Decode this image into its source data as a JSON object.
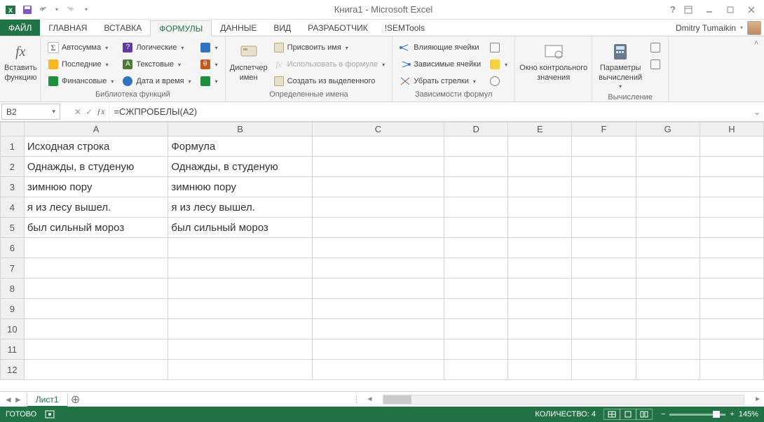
{
  "titlebar": {
    "title": "Книга1 - Microsoft Excel"
  },
  "tabs": {
    "file": "ФАЙЛ",
    "items": [
      "ГЛАВНАЯ",
      "ВСТАВКА",
      "ФОРМУЛЫ",
      "ДАННЫЕ",
      "ВИД",
      "РАЗРАБОТЧИК",
      "!SEMTools"
    ],
    "active": "ФОРМУЛЫ",
    "user": "Dmitry Tumaikin"
  },
  "ribbon": {
    "g0": {
      "label": "",
      "insert_fn_line1": "Вставить",
      "insert_fn_line2": "функцию"
    },
    "g1": {
      "label": "Библиотека функций",
      "autosum": "Автосумма",
      "recent": "Последние",
      "financial": "Финансовые",
      "logical": "Логические",
      "text": "Текстовые",
      "datetime": "Дата и время"
    },
    "g2": {
      "label": "Определенные имена",
      "name_mgr_line1": "Диспетчер",
      "name_mgr_line2": "имен",
      "define": "Присвоить имя",
      "use": "Использовать в формуле",
      "create": "Создать из выделенного"
    },
    "g3": {
      "label": "Зависимости формул",
      "precedents": "Влияющие ячейки",
      "dependents": "Зависимые ячейки",
      "remove": "Убрать стрелки"
    },
    "g4": {
      "label": "",
      "watch_line1": "Окно контрольного",
      "watch_line2": "значения"
    },
    "g5": {
      "label": "Вычисление",
      "calc_line1": "Параметры",
      "calc_line2": "вычислений"
    }
  },
  "fbar": {
    "cell": "B2",
    "formula": "=СЖПРОБЕЛЫ(A2)"
  },
  "grid": {
    "cols": [
      "A",
      "B",
      "C",
      "D",
      "E",
      "F",
      "G",
      "H"
    ],
    "rows": [
      1,
      2,
      3,
      4,
      5,
      6,
      7,
      8,
      9,
      10,
      11,
      12
    ],
    "data": {
      "A1": "Исходная строка",
      "B1": "Формула",
      "A2": "   Однажды, в студеную",
      "B2": "Однажды, в студеную",
      "A3": " зимнюю пору",
      "B3": "зимнюю пору",
      "A4": " я из лесу вышел.",
      "B4": "я из лесу вышел.",
      "A5": " был сильный мороз",
      "B5": "был сильный мороз"
    }
  },
  "sheets": {
    "active": "Лист1"
  },
  "status": {
    "ready": "ГОТОВО",
    "count": "КОЛИЧЕСТВО: 4",
    "zoom": "145%"
  }
}
